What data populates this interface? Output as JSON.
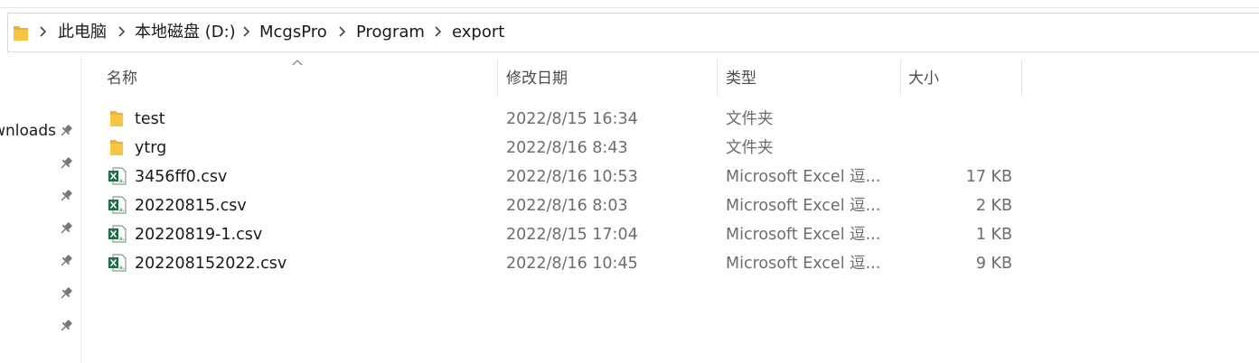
{
  "address": {
    "crumbs": [
      "此电脑",
      "本地磁盘 (D:)",
      "McgsPro",
      "Program",
      "export"
    ]
  },
  "nav": {
    "partial_label": "Downloads"
  },
  "columns": {
    "name": "名称",
    "date": "修改日期",
    "type": "类型",
    "size": "大小"
  },
  "files": [
    {
      "name": "test",
      "date": "2022/8/15 16:34",
      "type": "文件夹",
      "size": "",
      "icon": "folder-icon"
    },
    {
      "name": "ytrg",
      "date": "2022/8/16 8:43",
      "type": "文件夹",
      "size": "",
      "icon": "folder-icon"
    },
    {
      "name": "3456ff0.csv",
      "date": "2022/8/16 10:53",
      "type": "Microsoft Excel 逗...",
      "size": "17 KB",
      "icon": "excel-csv-icon"
    },
    {
      "name": "20220815.csv",
      "date": "2022/8/16 8:03",
      "type": "Microsoft Excel 逗...",
      "size": "2 KB",
      "icon": "excel-csv-icon"
    },
    {
      "name": "20220819-1.csv",
      "date": "2022/8/15 17:04",
      "type": "Microsoft Excel 逗...",
      "size": "1 KB",
      "icon": "excel-csv-icon"
    },
    {
      "name": "202208152022.csv",
      "date": "2022/8/16 10:45",
      "type": "Microsoft Excel 逗...",
      "size": "9 KB",
      "icon": "excel-csv-icon"
    }
  ],
  "colors": {
    "folder": "#f7c443",
    "excel": "#1d6f42"
  }
}
